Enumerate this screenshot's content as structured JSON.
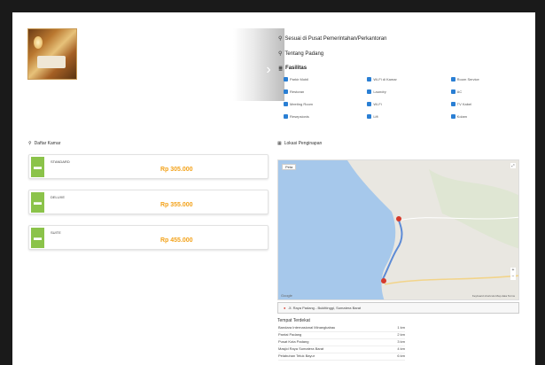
{
  "hero": {
    "next_icon": "chevron-right-icon",
    "next_glyph": "›"
  },
  "info": {
    "distance_label": "Sesuai di Pusat Pemerintahan/Perkantoran",
    "city_label": "Tentang Padang",
    "facilities_title": "Fasilitas",
    "facilities": [
      "Parkir Mobil",
      "Wi-Fi di Kamar",
      "Room Service",
      "Restoran",
      "Laundry",
      "AC",
      "Meeting Room",
      "Wi-Fi",
      "TV Kabel",
      "Resepsionis",
      "Lift",
      "Kolam"
    ]
  },
  "rooms": {
    "title": "Daftar Kamar",
    "items": [
      {
        "name": "STANDARD",
        "price": "Rp 305.000"
      },
      {
        "name": "DELUXE",
        "price": "Rp 355.000"
      },
      {
        "name": "SUITE",
        "price": "Rp 455.000"
      }
    ]
  },
  "map": {
    "title": "Lokasi Penginapan",
    "map_type_button": "Peta",
    "fullscreen_glyph": "⤢",
    "zoom_in": "+",
    "zoom_out": "−",
    "google_mark": "Google",
    "attribution": "Keyboard shortcuts   Map data   Terms",
    "address": "Jl. Raya Padang - Bukittinggi, Sumatera Barat"
  },
  "nearby": {
    "title": "Tempat Terdekat",
    "items": [
      {
        "name": "Bandara Internasional Minangkabau",
        "dist": "1 km"
      },
      {
        "name": "Pantai Padang",
        "dist": "2 km"
      },
      {
        "name": "Pusat Kota Padang",
        "dist": "3 km"
      },
      {
        "name": "Masjid Raya Sumatera Barat",
        "dist": "4 km"
      },
      {
        "name": "Pelabuhan Teluk Bayur",
        "dist": "6 km"
      }
    ]
  },
  "colors": {
    "price": "#f3a21a",
    "room_icon": "#8bc34a",
    "checkbox": "#2a7fd4",
    "water": "#a6c8eb",
    "pin": "#d63a2b"
  }
}
